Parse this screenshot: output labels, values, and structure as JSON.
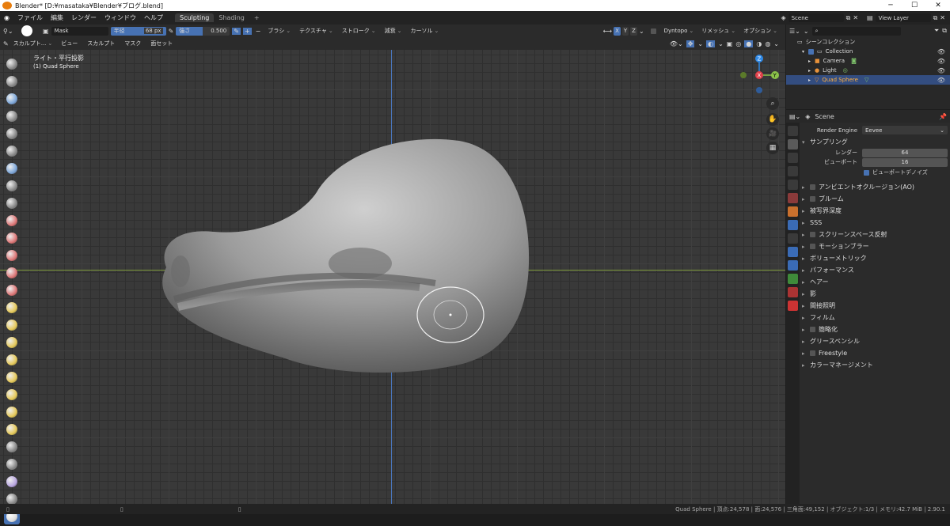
{
  "titlebar": {
    "title": "Blender* [D:¥masataka¥Blender¥ブログ.blend]"
  },
  "menu": {
    "items": [
      "ファイル",
      "編集",
      "レンダー",
      "ウィンドウ",
      "ヘルプ"
    ],
    "tabs": [
      "Sculpting",
      "Shading"
    ],
    "active_tab": "Sculpting"
  },
  "top_right": {
    "scene": "Scene",
    "view_layer": "View Layer"
  },
  "tool_header": {
    "brush_name": "Mask",
    "radius_label": "半径",
    "radius_value": "68 px",
    "strength_label": "強さ",
    "strength_value": "0.500",
    "menus": [
      "ブラシ",
      "テクスチャ",
      "ストローク",
      "減衰",
      "カーソル"
    ],
    "axes": [
      "X",
      "Y",
      "Z"
    ],
    "dyntopo": "Dyntopo",
    "remesh": "リメッシュ",
    "options": "オプション"
  },
  "sub_header": {
    "mode": "スカルプト...",
    "menus": [
      "ビュー",
      "スカルプト",
      "マスク",
      "面セット"
    ]
  },
  "viewport": {
    "overlay_text_1": "ライト・平行投影",
    "overlay_text_2": "(1) Quad Sphere"
  },
  "outliner": {
    "root": "シーンコレクション",
    "collection": "Collection",
    "items": [
      "Camera",
      "Light",
      "Quad Sphere"
    ],
    "selected": "Quad Sphere"
  },
  "properties": {
    "context": "Scene",
    "render_engine_label": "Render Engine",
    "render_engine": "Eevee",
    "sampling": "サンプリング",
    "render_label": "レンダー",
    "render_value": "64",
    "viewport_label": "ビューポート",
    "viewport_value": "16",
    "denoise": "ビューポートデノイズ",
    "sections": [
      "アンビエントオクルージョン(AO)",
      "ブルーム",
      "被写界深度",
      "SSS",
      "スクリーンスペース反射",
      "モーションブラー",
      "ボリューメトリック",
      "パフォーマンス",
      "ヘアー",
      "影",
      "間接照明",
      "フィルム",
      "簡略化",
      "グリースペンシル",
      "Freestyle",
      "カラーマネージメント"
    ],
    "section_has_checkbox": [
      true,
      true,
      false,
      false,
      true,
      true,
      false,
      false,
      false,
      false,
      false,
      false,
      true,
      false,
      true,
      false
    ]
  },
  "status": {
    "text": "Quad Sphere | 頂点:24,578 | 面:24,576 | 三角面:49,152 | オブジェクト:1/3 | メモリ:42.7 MiB | 2.90.1"
  },
  "colors": {
    "accent": "#4772b3",
    "x_axis": "#e0404a",
    "y_axis": "#8bc34a",
    "z_axis": "#2f8ae8"
  }
}
